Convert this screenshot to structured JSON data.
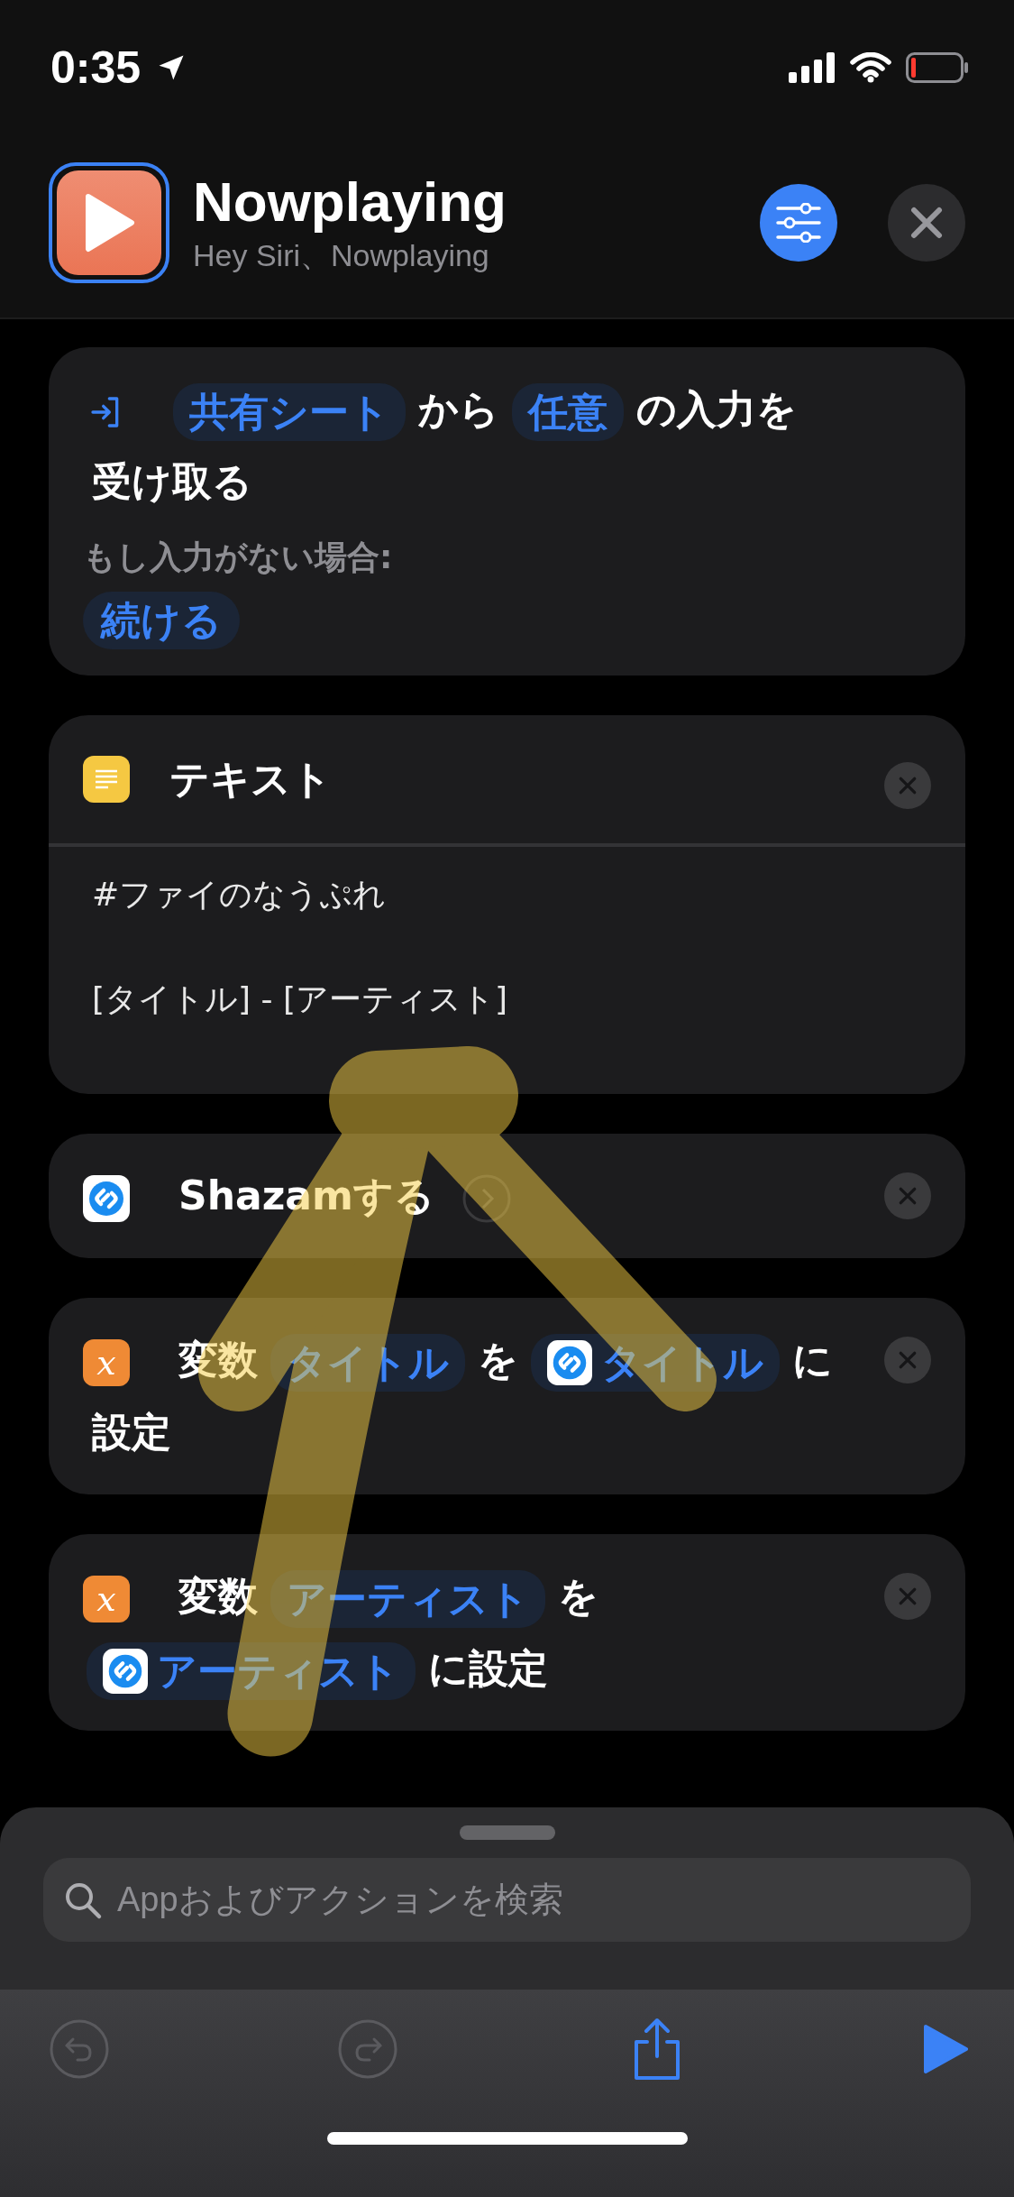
{
  "status_bar": {
    "time": "0:35"
  },
  "header": {
    "title": "Nowplaying",
    "subtitle": "Hey Siri、Nowplaying"
  },
  "actions": [
    {
      "kind": "receive",
      "closable": false,
      "parts": [
        {
          "kind": "token",
          "text": "共有シート"
        },
        {
          "kind": "text",
          "text": "から"
        },
        {
          "kind": "token",
          "text": "任意"
        },
        {
          "kind": "text",
          "text": "の入力を"
        },
        {
          "kind": "text",
          "text": "受け取る"
        }
      ],
      "note": "もし入力がない場合:",
      "option": "続ける"
    },
    {
      "kind": "text",
      "closable": true,
      "title": "テキスト",
      "body": "#ファイのなうぷれ\n\n[タイトル] - [アーティスト]"
    },
    {
      "kind": "shazam",
      "closable": true,
      "parts": [
        {
          "kind": "text",
          "text": "Shazamする"
        }
      ]
    },
    {
      "kind": "variable",
      "glyph": "x",
      "closable": true,
      "parts": [
        {
          "kind": "text",
          "text": "変数"
        },
        {
          "kind": "token",
          "text": "タイトル"
        },
        {
          "kind": "text",
          "text": "を"
        },
        {
          "kind": "app_token",
          "text": "タイトル"
        },
        {
          "kind": "text",
          "text": "に"
        },
        {
          "kind": "text",
          "text": "設定"
        }
      ]
    },
    {
      "kind": "variable",
      "glyph": "x",
      "closable": true,
      "parts": [
        {
          "kind": "text",
          "text": "変数"
        },
        {
          "kind": "token",
          "text": "アーティスト"
        },
        {
          "kind": "text",
          "text": "を"
        },
        {
          "kind": "app_token",
          "text": "アーティスト"
        },
        {
          "kind": "text",
          "text": "に設定"
        }
      ]
    }
  ],
  "search": {
    "placeholder": "Appおよびアクションを検索"
  },
  "toolbar": [
    {
      "kind": "undo",
      "disabled": true
    },
    {
      "kind": "redo",
      "disabled": true
    },
    {
      "kind": "share",
      "disabled": false
    },
    {
      "kind": "run",
      "disabled": false
    }
  ]
}
